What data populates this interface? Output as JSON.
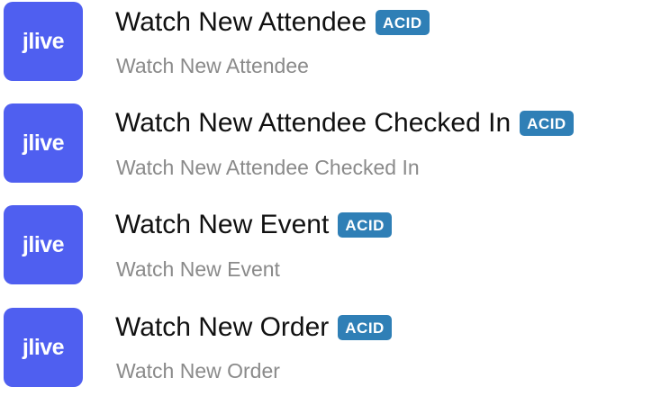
{
  "app_logo_text": "jlive",
  "badge_label": "ACID",
  "colors": {
    "logo_bg": "#4f5ff0",
    "badge_bg": "#2f7fb6",
    "title": "#111111",
    "subtitle": "#8a8a8a"
  },
  "triggers": [
    {
      "title": "Watch New Attendee",
      "subtitle": "Watch New Attendee"
    },
    {
      "title": "Watch New Attendee Checked In",
      "subtitle": "Watch New Attendee Checked In"
    },
    {
      "title": "Watch New Event",
      "subtitle": "Watch New Event"
    },
    {
      "title": "Watch New Order",
      "subtitle": "Watch New Order"
    }
  ]
}
